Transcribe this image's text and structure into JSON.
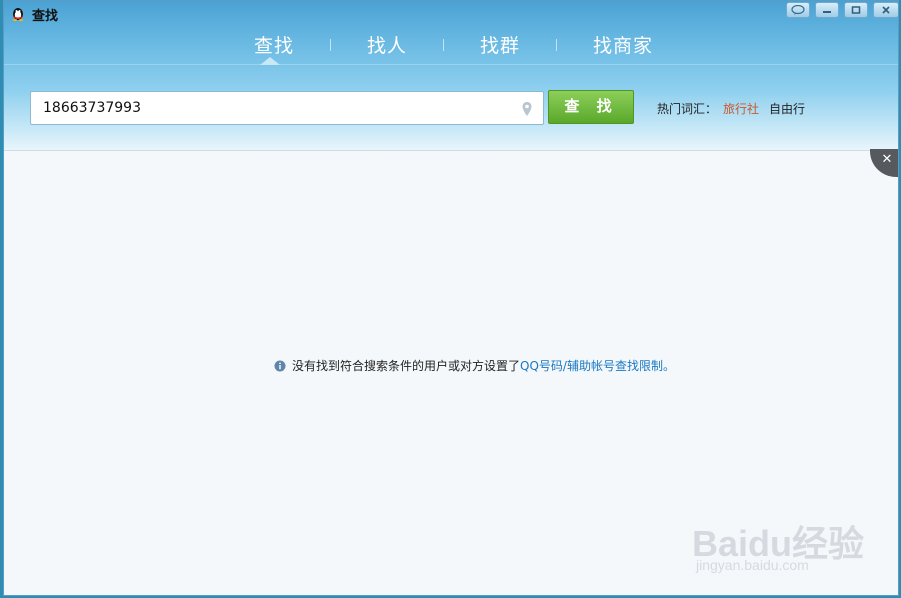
{
  "window": {
    "title": "查找"
  },
  "tabs": [
    {
      "label": "查找",
      "active": true
    },
    {
      "label": "找人"
    },
    {
      "label": "找群"
    },
    {
      "label": "找商家"
    }
  ],
  "search": {
    "value": "18663737993",
    "button_label": "查 找"
  },
  "hot_words": {
    "label": "热门词汇：",
    "items": [
      "旅行社",
      "自由行"
    ]
  },
  "message": {
    "text": "没有找到符合搜索条件的用户或对方设置了",
    "link": "QQ号码/辅助帐号查找限制。"
  },
  "watermark": {
    "main": "Baidu经验",
    "sub": "jingyan.baidu.com"
  },
  "colors": {
    "header_top": "#4aa2d3",
    "search_button": "#5aa82b",
    "hot_word_accent": "#c8582c",
    "link": "#1a78c2"
  }
}
